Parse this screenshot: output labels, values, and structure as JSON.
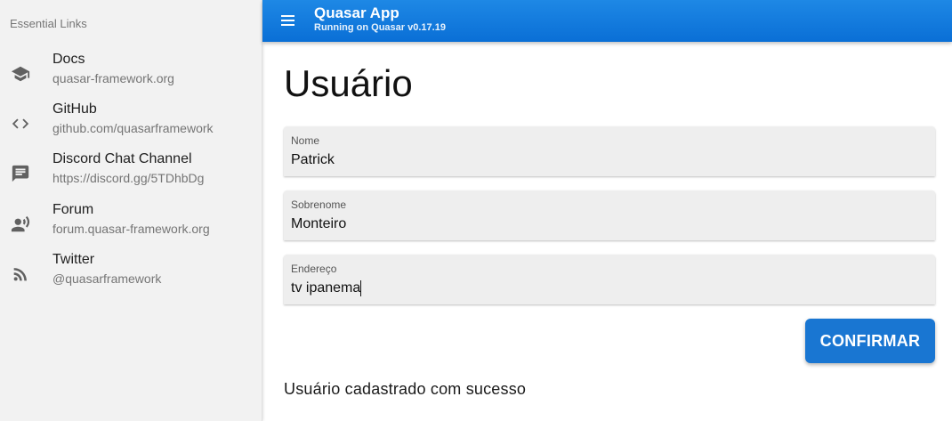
{
  "drawer": {
    "header": "Essential Links",
    "items": [
      {
        "icon": "school-icon",
        "label": "Docs",
        "sublabel": "quasar-framework.org"
      },
      {
        "icon": "code-icon",
        "label": "GitHub",
        "sublabel": "github.com/quasarframework"
      },
      {
        "icon": "chat-icon",
        "label": "Discord Chat Channel",
        "sublabel": "https://discord.gg/5TDhbDg"
      },
      {
        "icon": "record-voice-icon",
        "label": "Forum",
        "sublabel": "forum.quasar-framework.org"
      },
      {
        "icon": "rss-feed-icon",
        "label": "Twitter",
        "sublabel": "@quasarframework"
      }
    ]
  },
  "header": {
    "title": "Quasar App",
    "subtitle": "Running on Quasar v0.17.19",
    "menu_icon": "menu-icon"
  },
  "main": {
    "title": "Usuário",
    "fields": [
      {
        "label": "Nome",
        "value": "Patrick"
      },
      {
        "label": "Sobrenome",
        "value": "Monteiro"
      },
      {
        "label": "Endereço",
        "value": "tv ipanema"
      }
    ],
    "confirm_label": "CONFIRMAR",
    "success_message": "Usuário cadastrado com sucesso"
  },
  "colors": {
    "primary": "#1976d2",
    "header": "#1e88e5",
    "drawer_bg": "#f2f2f2",
    "field_bg": "#eeeeee"
  }
}
